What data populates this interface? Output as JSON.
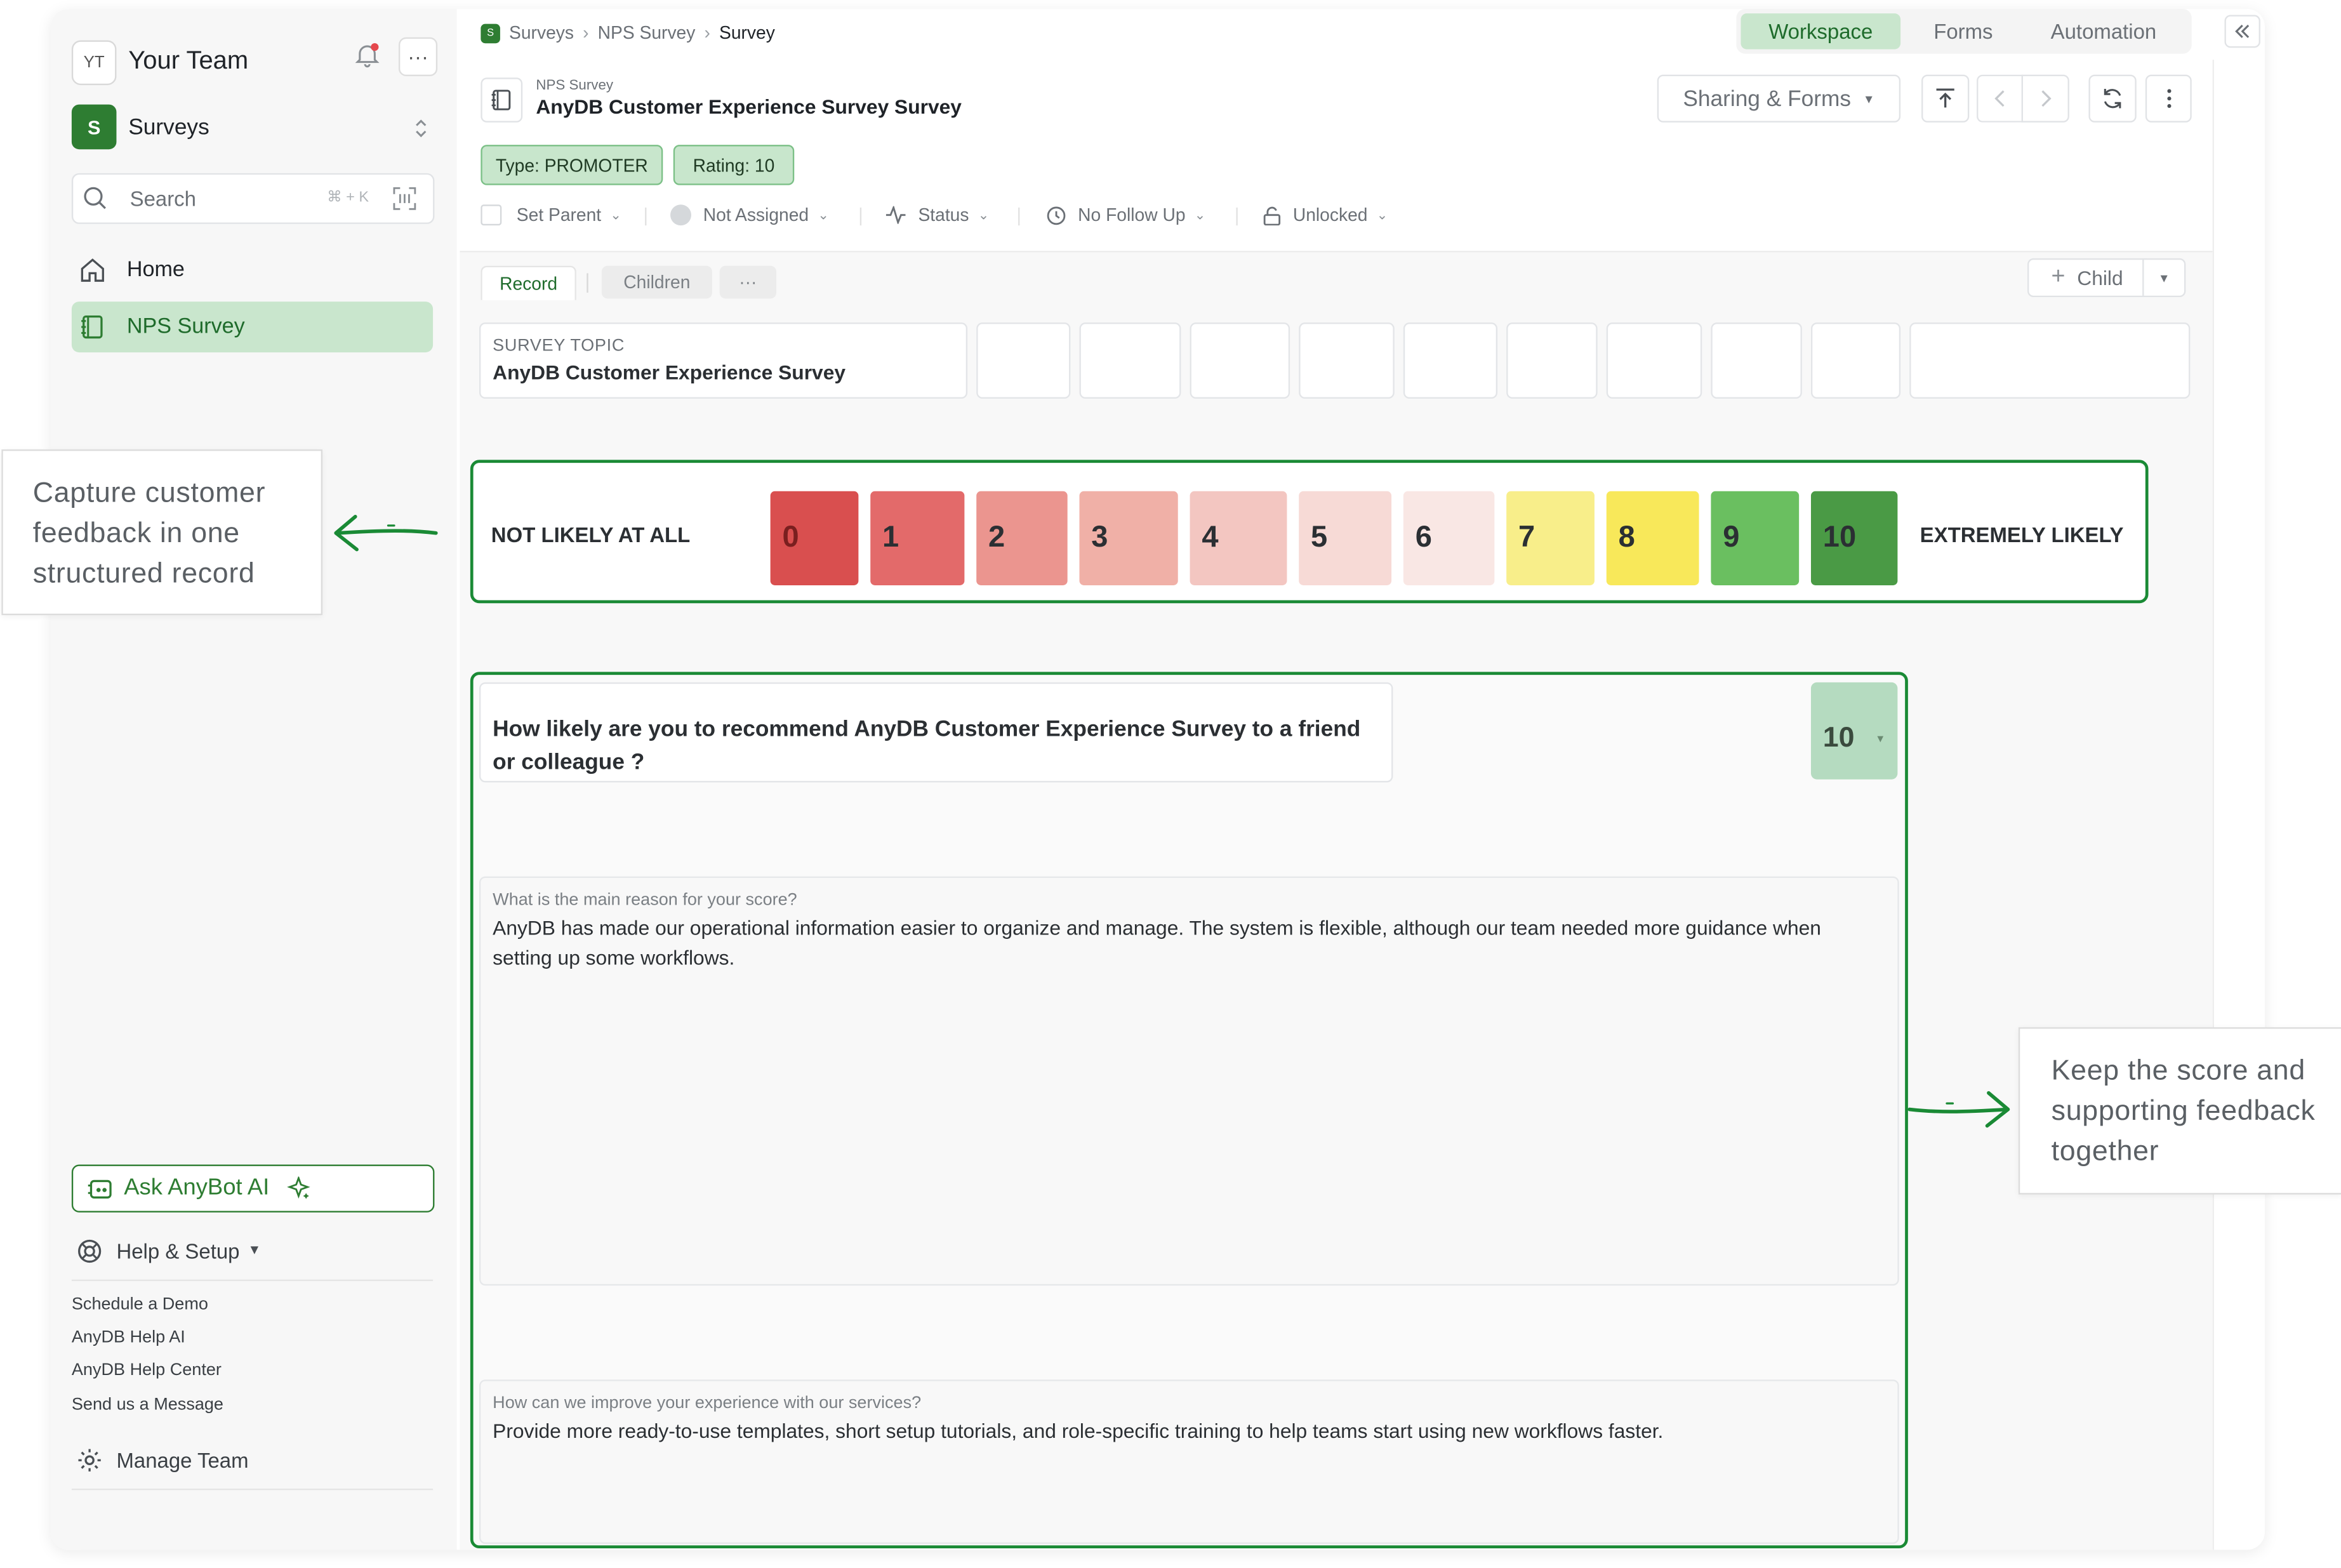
{
  "sidebar": {
    "team_initials": "YT",
    "team_name": "Your Team",
    "workspace_letter": "S",
    "workspace_name": "Surveys",
    "search_placeholder": "Search",
    "search_shortcut": "⌘ + K",
    "nav": [
      {
        "label": "Home",
        "icon": "home-icon"
      },
      {
        "label": "NPS Survey",
        "icon": "notebook-icon",
        "active": true
      }
    ],
    "ask_ai_label": "Ask AnyBot AI",
    "help_label": "Help & Setup",
    "help_links": [
      "Schedule a Demo",
      "AnyDB Help AI",
      "AnyDB Help Center",
      "Send us a Message"
    ],
    "manage_team_label": "Manage Team"
  },
  "header": {
    "breadcrumb": [
      "Surveys",
      "NPS Survey",
      "Survey"
    ],
    "breadcrumb_badge": "S",
    "tabs": [
      "Workspace",
      "Forms",
      "Automation"
    ],
    "active_tab": "Workspace",
    "record_parent": "NPS Survey",
    "record_title": "AnyDB Customer Experience Survey Survey",
    "sharing_label": "Sharing & Forms"
  },
  "tags": [
    "Type: PROMOTER",
    "Rating: 10"
  ],
  "meta": {
    "set_parent": "Set Parent",
    "assignee": "Not Assigned",
    "status": "Status",
    "follow_up": "No Follow Up",
    "lock": "Unlocked"
  },
  "record_tabs": [
    "Record",
    "Children",
    "···"
  ],
  "child_button": "Child",
  "survey_topic": {
    "label": "SURVEY TOPIC",
    "value": "AnyDB Customer Experience Survey"
  },
  "nps": {
    "low_label": "NOT LIKELY AT ALL",
    "high_label": "EXTREMELY LIKELY",
    "scale": [
      "0",
      "1",
      "2",
      "3",
      "4",
      "5",
      "6",
      "7",
      "8",
      "9",
      "10"
    ],
    "colors": [
      "#d94f4f",
      "#e36a6a",
      "#eb958f",
      "#f0b0a7",
      "#f3c6c1",
      "#f7dad6",
      "#f9e7e4",
      "#f8ee8a",
      "#f8e85a",
      "#6abf60",
      "#4a9a45"
    ]
  },
  "question": {
    "text": "How likely are you to recommend AnyDB Customer Experience Survey to a friend or colleague ?",
    "score": "10"
  },
  "reason": {
    "label": "What is the main reason for your score?",
    "text": "AnyDB has made our operational information easier to organize and manage. The system is flexible, although our team needed more guidance when setting up some workflows."
  },
  "improve": {
    "label": "How can we improve your experience with our services?",
    "text": "Provide more ready-to-use templates, short setup tutorials, and role-specific training to help teams start using new workflows faster."
  },
  "callouts": {
    "left": "Capture customer feedback in one structured record",
    "right": "Keep the score and supporting feedback together"
  },
  "accent": "#2e7d32"
}
